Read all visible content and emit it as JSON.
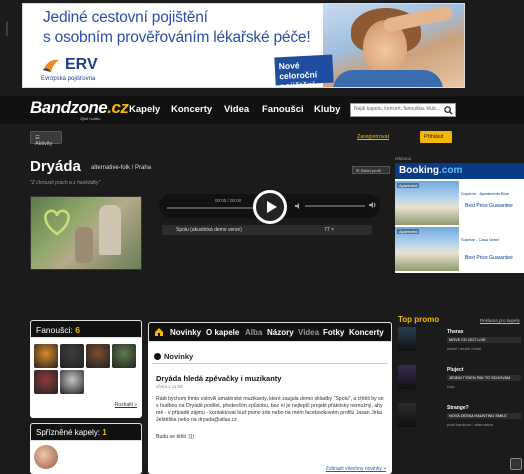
{
  "ad_banner": {
    "label": "reklama",
    "headline_line1": "Jediné cestovní pojištění",
    "headline_line2": "s osobním prověřováním lékařské péče!",
    "brand": "ERV",
    "brand_sub": "Evropská pojišťovna",
    "promo_line1": "Nové celoroční",
    "promo_line2": "pojištění"
  },
  "header": {
    "logo": "Bandzone",
    "logo_suffix": ".cz",
    "tagline": "Zjisti hudbu",
    "nav": [
      "Kapely",
      "Koncerty",
      "Videa",
      "Fanoušci",
      "Kluby"
    ],
    "search_placeholder": "Najdi kapelu, koncert, fanouška, klub..."
  },
  "toolbar": {
    "aktivity": "Aktivity",
    "register": "Zaregistrovat",
    "login": "Přihlásit"
  },
  "band": {
    "name": "Dryáda",
    "genre": "alternative-folk / Praha",
    "quote": "\"Z chrousti prach a z hankódky\"",
    "share": "Sdílet profil"
  },
  "player": {
    "time": "00:00 / 00:00",
    "track_title": "Spolu (akustická demo verze)",
    "play_count": "77 ×"
  },
  "booking": {
    "label": "reklama",
    "brand": "Booking",
    "brand_suffix": ".com",
    "items": [
      {
        "tag": "Apartment",
        "title": "Superior - Apartments Blue",
        "cta": "Best Price Guarantee"
      },
      {
        "tag": "Apartment",
        "title": "Supetar - Casa Varež",
        "cta": "Best Price Guarantee"
      }
    ]
  },
  "fans": {
    "title": "Fanoušci:",
    "count": "6",
    "more": "Rozbalit »",
    "colors": [
      "#d98a2a",
      "#3f3f3f",
      "#7a4e2d",
      "#5d7c4a",
      "#8d3a3a",
      "#c4c4c4"
    ]
  },
  "friends": {
    "title": "Spřízněné kapely:",
    "count": "1"
  },
  "tabs": {
    "items": [
      "Novinky",
      "O kapele",
      "Alba",
      "Názory",
      "Videa",
      "Fotky",
      "Koncerty"
    ]
  },
  "news": {
    "section": "Novinky",
    "post_title": "Dryáda hledá zpěvačky i muzikanty",
    "post_date": "včera v 11:58",
    "post_body": "Rádi bychom tímto oslovili amatérské muzikanty, které zaujala demo skladby \"Spolu\", a chtěli by se s hudbou na Dryádě podílet, především způsobu, bez ní je nejlepší projekt přátelsky nemožný, aby mě - v případě zájmu - kontaktovat buď primo zde nebo na mém facebookovém profilu Jasan Jirka Ještěška nebo na dryada@atlas.cz",
    "post_sig": "Budu se těšit :)))",
    "all_news": "Zobrazit všechny novinky »"
  },
  "top_promo": {
    "title": "Top promo",
    "link": "Reklama pro kapely",
    "items": [
      {
        "name": "Therax",
        "bar": "MOVE CD 2017 LIVE",
        "genre": "metal / death metal"
      },
      {
        "name": "Pluject",
        "bar": "JESEM TÝDEN PAK TO SCHOVÁM",
        "genre": "rock"
      },
      {
        "name": "Strange?",
        "bar": "NOVÁ DESKA HAUNTING SMILE",
        "genre": "post hardcore / alternative"
      }
    ],
    "thumb_colors": [
      "#2a3d52",
      "#3a2a52",
      "#2b2b2b"
    ]
  }
}
